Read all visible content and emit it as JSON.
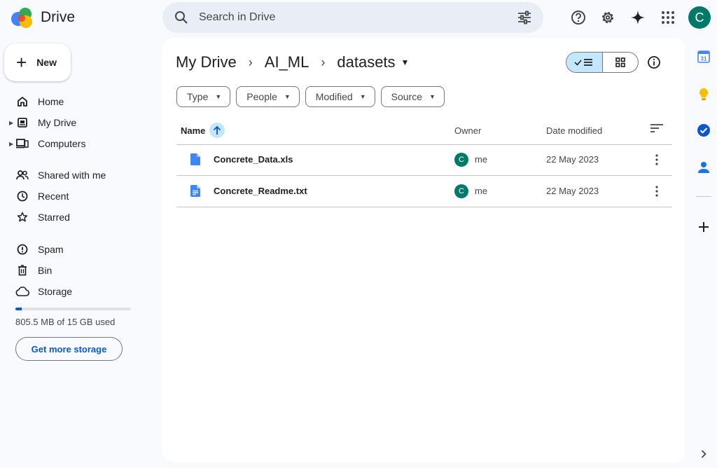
{
  "header": {
    "app_name": "Drive",
    "search_placeholder": "Search in Drive",
    "avatar_letter": "C"
  },
  "sidebar": {
    "new_label": "New",
    "items": [
      {
        "label": "Home",
        "icon": "home-icon"
      },
      {
        "label": "My Drive",
        "icon": "my-drive-icon"
      },
      {
        "label": "Computers",
        "icon": "computers-icon"
      },
      {
        "label": "Shared with me",
        "icon": "shared-icon"
      },
      {
        "label": "Recent",
        "icon": "clock-icon"
      },
      {
        "label": "Starred",
        "icon": "star-icon"
      },
      {
        "label": "Spam",
        "icon": "spam-icon"
      },
      {
        "label": "Bin",
        "icon": "bin-icon"
      },
      {
        "label": "Storage",
        "icon": "cloud-icon"
      }
    ],
    "storage_used_text": "805.5 MB of 15 GB used",
    "storage_fraction": 0.054,
    "get_storage_label": "Get more storage"
  },
  "breadcrumb": [
    "My Drive",
    "AI_ML",
    "datasets"
  ],
  "filters": [
    "Type",
    "People",
    "Modified",
    "Source"
  ],
  "table": {
    "columns": {
      "name": "Name",
      "owner": "Owner",
      "date": "Date modified"
    },
    "rows": [
      {
        "name": "Concrete_Data.xls",
        "owner_initial": "C",
        "owner": "me",
        "date": "22 May 2023",
        "icon": "doc-file-icon"
      },
      {
        "name": "Concrete_Readme.txt",
        "owner_initial": "C",
        "owner": "me",
        "date": "22 May 2023",
        "icon": "text-file-icon"
      }
    ]
  },
  "colors": {
    "accent": "#0b57d0",
    "selected": "#c2e7ff",
    "avatar": "#00796b",
    "file_icon": "#4285f4"
  }
}
